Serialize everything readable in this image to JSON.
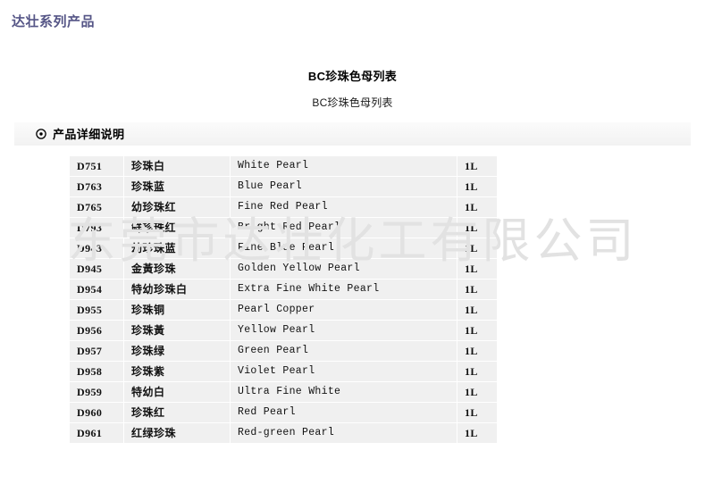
{
  "header": {
    "site_title": "达壮系列产品",
    "title_color": "#555586"
  },
  "document": {
    "title": "BC珍珠色母列表",
    "subtitle": "BC珍珠色母列表"
  },
  "section": {
    "icon": "circled-dot-icon",
    "title": "产品详细说明"
  },
  "watermark": {
    "text": "东莞市达壮化工有限公司",
    "color": "#e2e2e2"
  },
  "table": {
    "columns": [
      "code",
      "name_cn",
      "name_en",
      "unit"
    ],
    "rows": [
      {
        "code": "D751",
        "name_cn": "珍珠白",
        "name_en": "White Pearl",
        "unit": "1L"
      },
      {
        "code": "D763",
        "name_cn": "珍珠蓝",
        "name_en": "Blue Pearl",
        "unit": "1L"
      },
      {
        "code": "D765",
        "name_cn": "幼珍珠红",
        "name_en": "Fine Red Pearl",
        "unit": "1L"
      },
      {
        "code": "D793",
        "name_cn": "鲜珍珠红",
        "name_en": "Bright Red Pearl",
        "unit": "1L"
      },
      {
        "code": "D943",
        "name_cn": "幼珍珠蓝",
        "name_en": "Fine Blue Pearl",
        "unit": "1L"
      },
      {
        "code": "D945",
        "name_cn": "金黃珍珠",
        "name_en": "Golden Yellow Pearl",
        "unit": "1L"
      },
      {
        "code": "D954",
        "name_cn": "特幼珍珠白",
        "name_en": "Extra Fine White Pearl",
        "unit": "1L"
      },
      {
        "code": "D955",
        "name_cn": "珍珠铜",
        "name_en": "Pearl Copper",
        "unit": "1L"
      },
      {
        "code": "D956",
        "name_cn": "珍珠黃",
        "name_en": "Yellow Pearl",
        "unit": "1L"
      },
      {
        "code": "D957",
        "name_cn": "珍珠绿",
        "name_en": "Green Pearl",
        "unit": "1L"
      },
      {
        "code": "D958",
        "name_cn": "珍珠紫",
        "name_en": "Violet Pearl",
        "unit": "1L"
      },
      {
        "code": "D959",
        "name_cn": "特幼白",
        "name_en": "Ultra Fine White",
        "unit": "1L"
      },
      {
        "code": "D960",
        "name_cn": "珍珠红",
        "name_en": "Red Pearl",
        "unit": "1L"
      },
      {
        "code": "D961",
        "name_cn": "红绿珍珠",
        "name_en": "Red-green Pearl",
        "unit": "1L"
      }
    ]
  }
}
